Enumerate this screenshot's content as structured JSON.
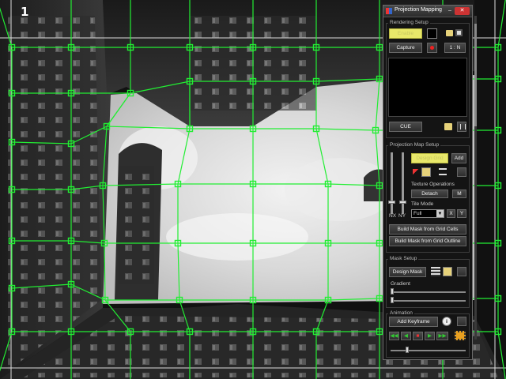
{
  "viewport": {
    "number": "1",
    "grid_color": "#22ee33"
  },
  "panel": {
    "title": "Projection Mapping",
    "minimize_glyph": "–",
    "close_glyph": "✕",
    "rendering": {
      "title": "Rendering Setup",
      "enable_label": "Enable",
      "capture_label": "Capture",
      "ratio_label": "1 : N",
      "cue_label": "CUE"
    },
    "projection_map": {
      "title": "Projection Map Setup",
      "design_grid_label": "Design Grid",
      "add_label": "Add",
      "texture_operations_label": "Texture Operations",
      "detach_label": "Detach",
      "m_label": "M",
      "tile_mode_label": "Tile Mode",
      "nx_label": "NX",
      "ny_label": "NY",
      "tile_mode_value": "Full",
      "x_label": "X",
      "y_label": "Y",
      "build_cells_label": "Build Mask from Grid Cells",
      "build_outline_label": "Build Mask from Grid Outline"
    },
    "mask": {
      "title": "Mask Setup",
      "design_mask_label": "Design Mask",
      "gradient_label": "Gradient"
    },
    "animation": {
      "title": "Animation",
      "add_keyframe_label": "Add Keyframe",
      "info_glyph": "i",
      "rewind_glyph": "◀◀",
      "prev_glyph": "◀",
      "stop_glyph": "■",
      "play_glyph": "▶",
      "ffwd_glyph": "▶▶"
    }
  }
}
